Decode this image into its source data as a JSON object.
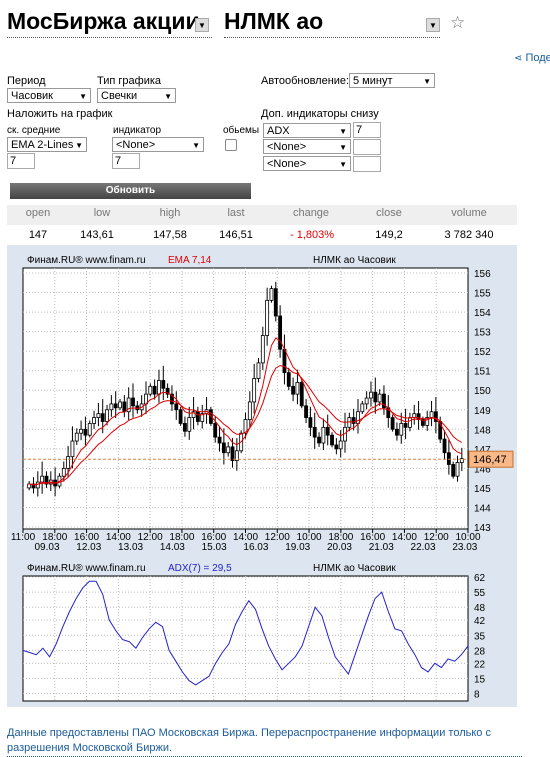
{
  "header": {
    "market": "МосБиржа акции",
    "ticker": "НЛМК ао",
    "share": "Поде"
  },
  "controls": {
    "period_label": "Период",
    "period_value": "Часовик",
    "chart_type_label": "Тип графика",
    "chart_type_value": "Свечки",
    "autorefresh_label": "Автообновление:",
    "autorefresh_value": "5 минут",
    "overlay_label": "Наложить на график",
    "ma_label": "ск. средние",
    "ma_value": "EMA 2-Lines",
    "ma_period": "7",
    "indicator_label": "индикатор",
    "indicator_value": "<None>",
    "indicator_period": "7",
    "volumes_label": "обьемы",
    "extra_label": "Доп. индикаторы снизу",
    "extra1": "ADX",
    "extra1_period": "7",
    "extra2": "<None>",
    "extra3": "<None>",
    "refresh_button": "Обновить"
  },
  "quote": {
    "headers": [
      "open",
      "low",
      "high",
      "last",
      "change",
      "close",
      "volume"
    ],
    "values": [
      "147",
      "143,61",
      "147,58",
      "146,51",
      "- 1,803%",
      "149,2",
      "3 782 340"
    ],
    "change_color": "#e00000"
  },
  "chart_data": [
    {
      "type": "candlestick",
      "source": "Финам.RU® www.finam.ru",
      "indicator_label": "EMA 7,14",
      "caption": "НЛМК ао Часовик",
      "ylim": [
        143,
        156
      ],
      "y_ticks": [
        "156",
        "155",
        "154",
        "153",
        "152",
        "151",
        "150",
        "149",
        "148",
        "147",
        "146",
        "145",
        "144",
        "143"
      ],
      "last_price": "146,47",
      "x_time_labels": [
        "11:00",
        "18:00",
        "16:00",
        "14:00",
        "12:00",
        "18:00",
        "16:00",
        "14:00",
        "12:00",
        "10:00",
        "18:00",
        "16:00",
        "14:00",
        "12:00",
        "10:00"
      ],
      "x_date_labels": [
        "09.03",
        "12.03",
        "13.03",
        "14.03",
        "15.03",
        "16.03",
        "19.03",
        "20.03",
        "21.03",
        "22.03",
        "23.03"
      ],
      "close_path": [
        145.2,
        145.0,
        145.3,
        145.6,
        145.2,
        145.4,
        145.1,
        145.6,
        146.0,
        146.6,
        147.4,
        147.8,
        148.0,
        147.7,
        148.3,
        148.6,
        148.8,
        148.4,
        149.0,
        149.3,
        149.1,
        149.4,
        148.9,
        149.6,
        149.2,
        149.0,
        149.3,
        149.8,
        150.2,
        149.8,
        150.5,
        150.1,
        149.8,
        149.3,
        149.0,
        148.3,
        147.9,
        148.6,
        148.9,
        148.4,
        148.8,
        149.0,
        148.3,
        147.6,
        147.3,
        146.8,
        147.1,
        146.4,
        146.9,
        147.8,
        148.5,
        149.4,
        150.6,
        151.4,
        152.8,
        154.6,
        155.2,
        153.8,
        152.1,
        150.9,
        150.2,
        149.8,
        150.4,
        149.2,
        148.6,
        148.1,
        147.6,
        147.3,
        148.1,
        147.7,
        147.2,
        147.0,
        147.4,
        148.1,
        148.6,
        148.3,
        148.9,
        149.3,
        149.6,
        149.9,
        149.4,
        149.8,
        149.1,
        148.6,
        148.0,
        147.7,
        148.3,
        148.1,
        148.6,
        148.8,
        148.5,
        148.2,
        148.6,
        148.9,
        148.4,
        147.5,
        146.8,
        146.2,
        145.6,
        146.3,
        146.5
      ],
      "ema_fast_color": "#e00000",
      "ema_slow_color": "#e00000"
    },
    {
      "type": "line",
      "source": "Финам.RU® www.finam.ru",
      "indicator_label": "ADX(7) = 29,5",
      "caption": "НЛМК ао Часовик",
      "ylim": [
        5,
        62
      ],
      "y_ticks": [
        "62",
        "55",
        "48",
        "42",
        "35",
        "28",
        "22",
        "15",
        "8"
      ],
      "values": [
        28,
        27,
        26,
        29,
        25,
        31,
        39,
        46,
        52,
        57,
        60,
        60,
        54,
        42,
        37,
        33,
        32,
        29,
        34,
        38,
        41,
        39,
        28,
        23,
        18,
        14,
        12,
        14,
        16,
        22,
        27,
        31,
        40,
        46,
        51,
        47,
        38,
        30,
        24,
        19,
        22,
        25,
        30,
        39,
        48,
        44,
        34,
        25,
        21,
        17,
        26,
        35,
        44,
        52,
        55,
        46,
        38,
        37,
        31,
        26,
        20,
        18,
        22,
        20,
        24,
        23,
        26,
        30
      ],
      "line_color": "#2222cc"
    }
  ],
  "footer": {
    "text": "Данные предоставлены ПАО Московская Биржа. Перераспространение информации только с разрешения Московской Биржи."
  }
}
